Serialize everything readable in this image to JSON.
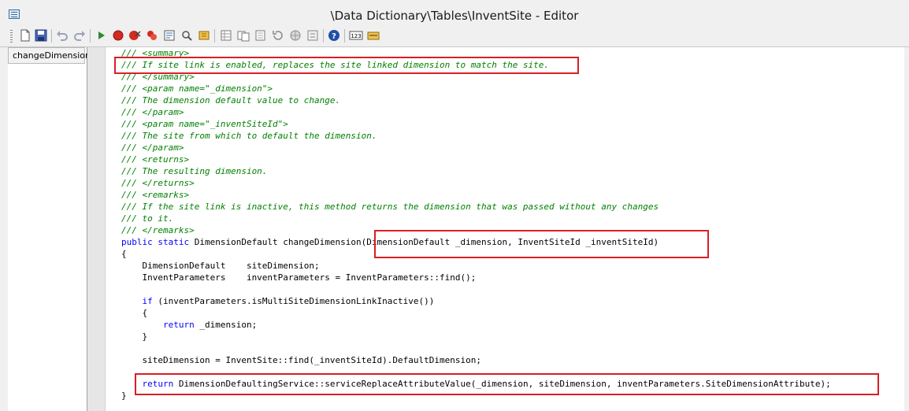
{
  "window": {
    "title": "\\Data Dictionary\\Tables\\InventSite - Editor"
  },
  "toolbar": {
    "buttons": [
      "new-icon",
      "save-icon",
      "undo-icon",
      "redo-icon",
      "run-icon",
      "breakpoint-icon",
      "clear-breakpoints-icon",
      "enable-breakpoint-icon",
      "compile-icon",
      "find-icon",
      "lookup-icon",
      "list-tables-icon",
      "list-fields-icon",
      "scripts-icon",
      "history-icon",
      "web-icon",
      "properties-icon",
      "help-icon",
      "line-number-icon",
      "script-icon"
    ]
  },
  "methods": {
    "items": [
      {
        "label": "changeDimension"
      }
    ]
  },
  "code": {
    "lines": [
      {
        "type": "comment",
        "text": "/// <summary>"
      },
      {
        "type": "comment",
        "text": "/// If site link is enabled, replaces the site linked dimension to match the site."
      },
      {
        "type": "comment",
        "text": "/// </summary>"
      },
      {
        "type": "comment",
        "text": "/// <param name=\"_dimension\">"
      },
      {
        "type": "comment",
        "text": "/// The dimension default value to change."
      },
      {
        "type": "comment",
        "text": "/// </param>"
      },
      {
        "type": "comment",
        "text": "/// <param name=\"_inventSiteId\">"
      },
      {
        "type": "comment",
        "text": "/// The site from which to default the dimension."
      },
      {
        "type": "comment",
        "text": "/// </param>"
      },
      {
        "type": "comment",
        "text": "/// <returns>"
      },
      {
        "type": "comment",
        "text": "/// The resulting dimension."
      },
      {
        "type": "comment",
        "text": "/// </returns>"
      },
      {
        "type": "comment",
        "text": "/// <remarks>"
      },
      {
        "type": "comment",
        "text": "/// If the site link is inactive, this method returns the dimension that was passed without any changes"
      },
      {
        "type": "comment",
        "text": "/// to it."
      },
      {
        "type": "comment",
        "text": "/// </remarks>"
      },
      {
        "type": "code",
        "kw": "public static",
        "text": " DimensionDefault changeDimension(DimensionDefault _dimension, InventSiteId _inventSiteId)"
      },
      {
        "type": "code",
        "text": "{"
      },
      {
        "type": "code",
        "text": "    DimensionDefault    siteDimension;"
      },
      {
        "type": "code",
        "text": "    InventParameters    inventParameters = InventParameters::find();"
      },
      {
        "type": "code",
        "text": ""
      },
      {
        "type": "code",
        "indent": "    ",
        "kw": "if",
        "text": " (inventParameters.isMultiSiteDimensionLinkInactive())"
      },
      {
        "type": "code",
        "text": "    {"
      },
      {
        "type": "code",
        "indent": "        ",
        "kw": "return",
        "text": " _dimension;"
      },
      {
        "type": "code",
        "text": "    }"
      },
      {
        "type": "code",
        "text": ""
      },
      {
        "type": "code",
        "text": "    siteDimension = InventSite::find(_inventSiteId).DefaultDimension;"
      },
      {
        "type": "code",
        "text": ""
      },
      {
        "type": "code",
        "indent": "    ",
        "kw": "return",
        "text": " DimensionDefaultingService::serviceReplaceAttributeValue(_dimension, siteDimension, inventParameters.SiteDimensionAttribute);"
      },
      {
        "type": "code",
        "text": "}"
      }
    ]
  },
  "highlight_color": "#d81f26"
}
